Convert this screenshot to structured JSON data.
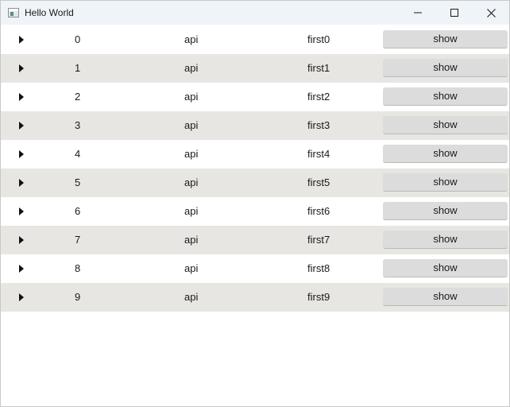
{
  "window": {
    "title": "Hello World",
    "icon": "app-window-icon",
    "controls": [
      "minimize-icon",
      "maximize-icon",
      "close-icon"
    ]
  },
  "rows": [
    {
      "index": "0",
      "category": "api",
      "name": "first0",
      "action_label": "show"
    },
    {
      "index": "1",
      "category": "api",
      "name": "first1",
      "action_label": "show"
    },
    {
      "index": "2",
      "category": "api",
      "name": "first2",
      "action_label": "show"
    },
    {
      "index": "3",
      "category": "api",
      "name": "first3",
      "action_label": "show"
    },
    {
      "index": "4",
      "category": "api",
      "name": "first4",
      "action_label": "show"
    },
    {
      "index": "5",
      "category": "api",
      "name": "first5",
      "action_label": "show"
    },
    {
      "index": "6",
      "category": "api",
      "name": "first6",
      "action_label": "show"
    },
    {
      "index": "7",
      "category": "api",
      "name": "first7",
      "action_label": "show"
    },
    {
      "index": "8",
      "category": "api",
      "name": "first8",
      "action_label": "show"
    },
    {
      "index": "9",
      "category": "api",
      "name": "first9",
      "action_label": "show"
    }
  ],
  "colors": {
    "titlebar_bg": "#eff4f9",
    "row_bg": "#ffffff",
    "row_alt_bg": "#e8e6e3",
    "button_bg": "#dcdcdc"
  }
}
